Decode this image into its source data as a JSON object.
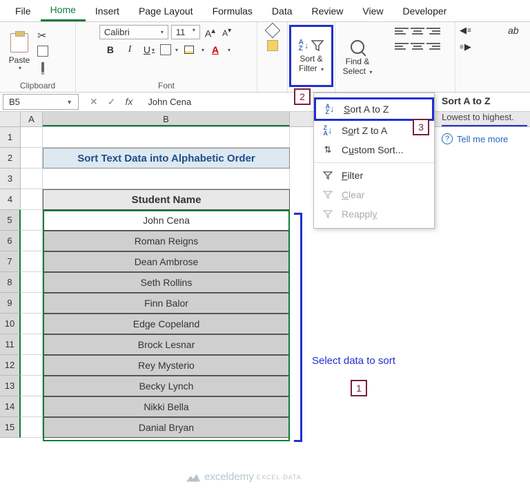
{
  "tabs": [
    "File",
    "Home",
    "Insert",
    "Page Layout",
    "Formulas",
    "Data",
    "Review",
    "View",
    "Developer"
  ],
  "activeTab": "Home",
  "ribbon": {
    "clipboard": {
      "paste": "Paste",
      "label": "Clipboard"
    },
    "font": {
      "name": "Calibri",
      "size": "11",
      "label": "Font",
      "b": "B",
      "i": "I",
      "u": "U",
      "a": "A"
    },
    "sortFilter": {
      "label": "Sort &\nFilter"
    },
    "findSelect": {
      "label": "Find &\nSelect"
    }
  },
  "namebox": "B5",
  "formula": "John Cena",
  "columns": [
    "A",
    "B"
  ],
  "titleRow": "Sort Text Data into Alphabetic Order",
  "headerRow": "Student Name",
  "data": [
    "John Cena",
    "Roman Reigns",
    "Dean Ambrose",
    "Seth Rollins",
    "Finn Balor",
    "Edge Copeland",
    "Brock Lesnar",
    "Rey Mysterio",
    "Becky Lynch",
    "Nikki Bella",
    "Danial Bryan"
  ],
  "dropdown": {
    "sortAZ": "Sort A to Z",
    "sortZA": "Sort Z to A",
    "custom": "Custom Sort...",
    "filter": "Filter",
    "clear": "Clear",
    "reapply": "Reapply"
  },
  "tooltip": {
    "title": "Sort A to Z",
    "desc": "Lowest to highest.",
    "link": "Tell me more"
  },
  "callouts": {
    "c1": "1",
    "c2": "2",
    "c3": "3"
  },
  "annotation": "Select data to sort",
  "watermark": "exceldemy"
}
